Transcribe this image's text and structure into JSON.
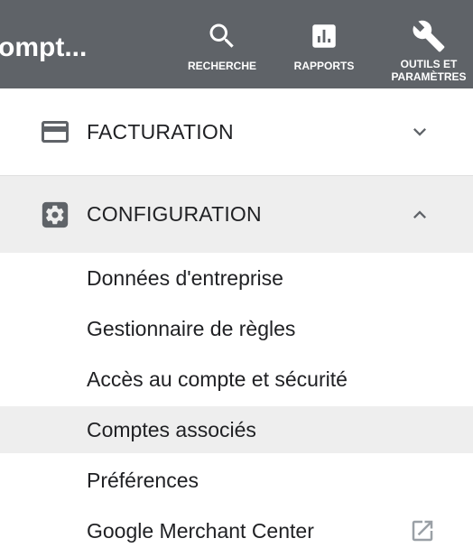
{
  "header": {
    "account_name": "ompt...",
    "background": "#5f6368",
    "tools": [
      {
        "label": "RECHERCHE",
        "icon": "search-icon"
      },
      {
        "label": "RAPPORTS",
        "icon": "bar-chart-icon"
      },
      {
        "label_line1": "OUTILS ET",
        "label_line2": "PARAMÈTRES",
        "icon": "wrench-icon"
      }
    ]
  },
  "sections": {
    "billing": {
      "label": "FACTURATION",
      "icon": "credit-card-icon",
      "state": "collapsed"
    },
    "setup": {
      "label": "CONFIGURATION",
      "icon": "gear-icon",
      "state": "expanded"
    }
  },
  "setup_items": [
    {
      "label": "Données d'entreprise"
    },
    {
      "label": "Gestionnaire de règles"
    },
    {
      "label": "Accès au compte et sécurité"
    },
    {
      "label": "Comptes associés",
      "active": true
    },
    {
      "label": "Préférences"
    },
    {
      "label": "Google Merchant Center",
      "icon": "open-in-new-icon"
    }
  ],
  "colors": {
    "highlight": "#eeeeee",
    "text": "#202124",
    "icon_gray": "#5f6368"
  }
}
